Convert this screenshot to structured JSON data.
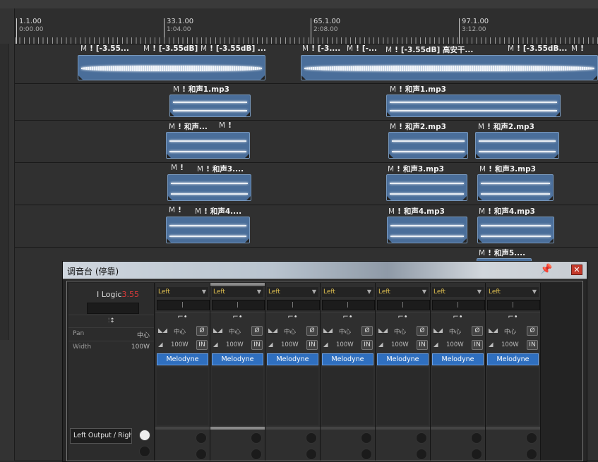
{
  "ruler": {
    "markers": [
      {
        "bar": "1.1.00",
        "time": "0:00.00"
      },
      {
        "bar": "33.1.00",
        "time": "1:04.00"
      },
      {
        "bar": "65.1.00",
        "time": "2:08.00"
      },
      {
        "bar": "97.1.00",
        "time": "3:12.00"
      }
    ]
  },
  "tracks": [
    {
      "clips": [
        {
          "m": "M",
          "ex": "!",
          "name": "[-3.55..."
        },
        {
          "m": "M",
          "ex": "!",
          "name": "[-3.55dB]"
        },
        {
          "m": "M",
          "ex": "!",
          "name": "[-3.55dB] ..."
        },
        {
          "m": "M",
          "ex": "!",
          "name": "[-3...."
        },
        {
          "m": "M",
          "ex": "!",
          "name": "[-..."
        },
        {
          "m": "M",
          "ex": "!",
          "name": "[-3.55dB] 高安干..."
        },
        {
          "m": "M",
          "ex": "!",
          "name": "[-3.55dB..."
        },
        {
          "m": "M",
          "ex": "!",
          "name": ""
        }
      ]
    },
    {
      "clips": [
        {
          "m": "M",
          "ex": "!",
          "name": "和声1.mp3"
        },
        {
          "m": "M",
          "ex": "!",
          "name": "和声1.mp3"
        }
      ]
    },
    {
      "clips": [
        {
          "m": "M",
          "ex": "!",
          "name": "和声..."
        },
        {
          "m": "M",
          "ex": "!",
          "name": ""
        },
        {
          "m": "M",
          "ex": "!",
          "name": "和声2.mp3"
        },
        {
          "m": "M",
          "ex": "!",
          "name": "和声2.mp3"
        }
      ]
    },
    {
      "clips": [
        {
          "m": "M",
          "ex": "!",
          "name": ""
        },
        {
          "m": "M",
          "ex": "!",
          "name": "和声3...."
        },
        {
          "m": "M",
          "ex": "!",
          "name": "和声3.mp3"
        },
        {
          "m": "M",
          "ex": "!",
          "name": "和声3.mp3"
        }
      ]
    },
    {
      "clips": [
        {
          "m": "M",
          "ex": "!",
          "name": ""
        },
        {
          "m": "M",
          "ex": "!",
          "name": "和声4...."
        },
        {
          "m": "M",
          "ex": "!",
          "name": "和声4.mp3"
        },
        {
          "m": "M",
          "ex": "!",
          "name": "和声4.mp3"
        }
      ]
    },
    {
      "clips": [
        {
          "m": "M",
          "ex": "!",
          "name": "和声5...."
        }
      ]
    }
  ],
  "mixer": {
    "title": "调音台 (停靠)",
    "pin_icon": "📌",
    "close_label": "✕",
    "brand_main": "I Logic",
    "brand_ver": "3.55",
    "pan_label": "Pan",
    "width_label": "Width",
    "label_pan_value": "中心",
    "label_width_value": "100W",
    "output_label": "Left Output / Righ",
    "channels": [
      {
        "input": "Left",
        "pan": "中心",
        "width": "100W",
        "phase": "Ø",
        "in": "IN",
        "plugin": "Melodyne"
      },
      {
        "input": "Left",
        "pan": "中心",
        "width": "100W",
        "phase": "Ø",
        "in": "IN",
        "plugin": "Melodyne"
      },
      {
        "input": "Left",
        "pan": "中心",
        "width": "100W",
        "phase": "Ø",
        "in": "IN",
        "plugin": "Melodyne"
      },
      {
        "input": "Left",
        "pan": "中心",
        "width": "100W",
        "phase": "Ø",
        "in": "IN",
        "plugin": "Melodyne"
      },
      {
        "input": "Left",
        "pan": "中心",
        "width": "100W",
        "phase": "Ø",
        "in": "IN",
        "plugin": "Melodyne"
      },
      {
        "input": "Left",
        "pan": "中心",
        "width": "100W",
        "phase": "Ø",
        "in": "IN",
        "plugin": "Melodyne"
      },
      {
        "input": "Left",
        "pan": "中心",
        "width": "100W",
        "phase": "Ø",
        "in": "IN",
        "plugin": "Melodyne"
      }
    ]
  },
  "colors": {
    "clip_fill": "#4a6e9a",
    "plugin_blue": "#2f6fbf",
    "input_text": "#e0c050",
    "close_red": "#c3392b",
    "brand_red": "#e23b3b"
  }
}
